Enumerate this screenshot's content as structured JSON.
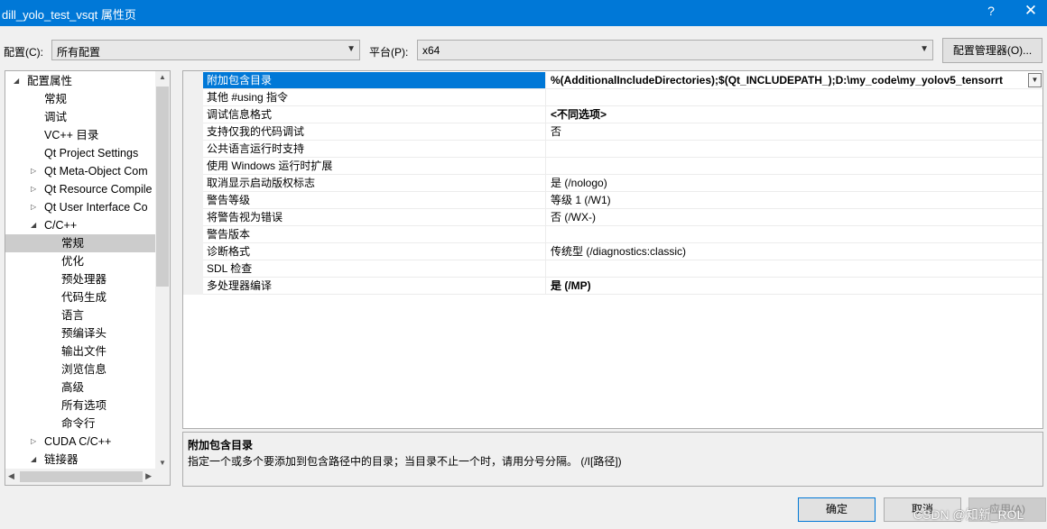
{
  "window": {
    "title": "dill_yolo_test_vsqt 属性页",
    "help_glyph": "?",
    "close_glyph": "✕"
  },
  "toolbar": {
    "config_label": "配置(C):",
    "config_value": "所有配置",
    "platform_label": "平台(P):",
    "platform_value": "x64",
    "config_manager_button": "配置管理器(O)..."
  },
  "tree": {
    "items": [
      {
        "label": "配置属性",
        "level": 0,
        "expander": "expanded"
      },
      {
        "label": "常规",
        "level": 1
      },
      {
        "label": "调试",
        "level": 1
      },
      {
        "label": "VC++ 目录",
        "level": 1
      },
      {
        "label": "Qt Project Settings",
        "level": 1
      },
      {
        "label": "Qt Meta-Object Com",
        "level": 1,
        "expander": "collapsed"
      },
      {
        "label": "Qt Resource Compile",
        "level": 1,
        "expander": "collapsed"
      },
      {
        "label": "Qt User Interface Co",
        "level": 1,
        "expander": "collapsed"
      },
      {
        "label": "C/C++",
        "level": 1,
        "expander": "expanded"
      },
      {
        "label": "常规",
        "level": 2,
        "selected": true
      },
      {
        "label": "优化",
        "level": 2
      },
      {
        "label": "预处理器",
        "level": 2
      },
      {
        "label": "代码生成",
        "level": 2
      },
      {
        "label": "语言",
        "level": 2
      },
      {
        "label": "预编译头",
        "level": 2
      },
      {
        "label": "输出文件",
        "level": 2
      },
      {
        "label": "浏览信息",
        "level": 2
      },
      {
        "label": "高级",
        "level": 2
      },
      {
        "label": "所有选项",
        "level": 2
      },
      {
        "label": "命令行",
        "level": 2
      },
      {
        "label": "CUDA C/C++",
        "level": 1,
        "expander": "collapsed"
      },
      {
        "label": "链接器",
        "level": 1,
        "expander": "expanded"
      }
    ]
  },
  "properties": [
    {
      "name": "附加包含目录",
      "value": "%(AdditionalIncludeDirectories);$(Qt_INCLUDEPATH_);D:\\my_code\\my_yolov5_tensorrt",
      "bold": true,
      "selected": true,
      "dropdown": true
    },
    {
      "name": "其他 #using 指令",
      "value": ""
    },
    {
      "name": "调试信息格式",
      "value": "<不同选项>",
      "bold": true
    },
    {
      "name": "支持仅我的代码调试",
      "value": "否"
    },
    {
      "name": "公共语言运行时支持",
      "value": ""
    },
    {
      "name": "使用 Windows 运行时扩展",
      "value": ""
    },
    {
      "name": "取消显示启动版权标志",
      "value": "是 (/nologo)"
    },
    {
      "name": "警告等级",
      "value": "等级 1 (/W1)"
    },
    {
      "name": "将警告视为错误",
      "value": "否 (/WX-)"
    },
    {
      "name": "警告版本",
      "value": ""
    },
    {
      "name": "诊断格式",
      "value": "传统型 (/diagnostics:classic)"
    },
    {
      "name": "SDL 检查",
      "value": ""
    },
    {
      "name": "多处理器编译",
      "value": "是 (/MP)",
      "bold": true
    }
  ],
  "description": {
    "title": "附加包含目录",
    "text": "指定一个或多个要添加到包含路径中的目录；当目录不止一个时，请用分号分隔。     (/I[路径])"
  },
  "buttons": {
    "ok": "确定",
    "cancel": "取消",
    "apply": "应用(A)"
  },
  "watermark": "CSDN @知新_ROL",
  "colors": {
    "titlebar": "#0078d7",
    "selection": "#0078d7",
    "tree_selection": "#cccccc"
  }
}
